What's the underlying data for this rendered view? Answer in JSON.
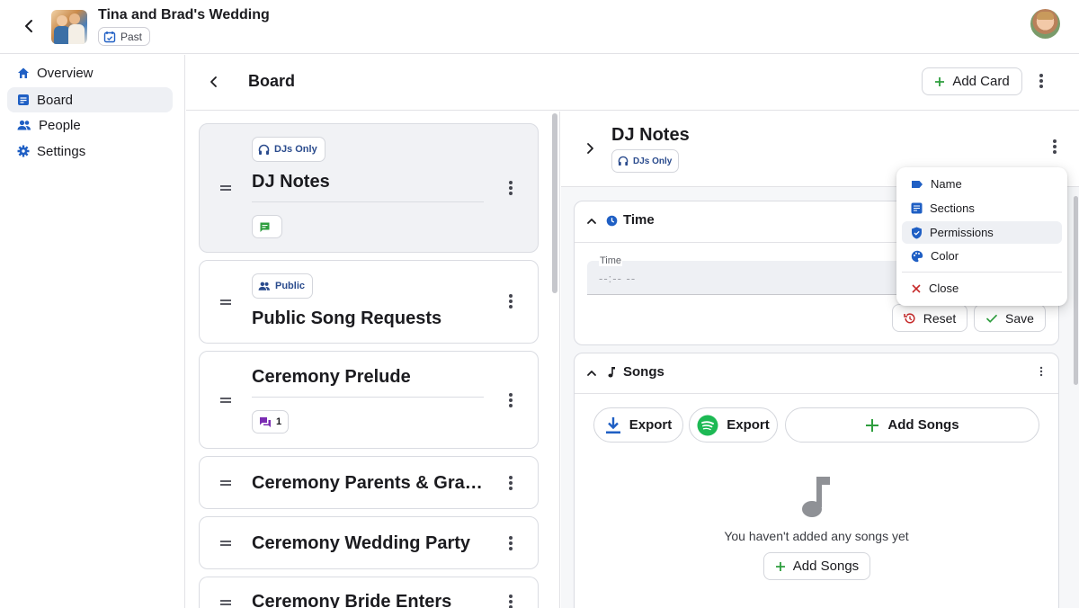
{
  "header": {
    "title": "Tina and Brad's Wedding",
    "status_chip": "Past"
  },
  "sidebar": {
    "items": [
      {
        "label": "Overview",
        "icon": "home-icon"
      },
      {
        "label": "Board",
        "icon": "board-icon",
        "active": true
      },
      {
        "label": "People",
        "icon": "people-icon"
      },
      {
        "label": "Settings",
        "icon": "gear-icon"
      }
    ]
  },
  "board": {
    "title": "Board",
    "add_card_label": "Add Card",
    "cards": [
      {
        "title": "DJ Notes",
        "chip": "DJs Only",
        "icon_chip": "",
        "selected": true
      },
      {
        "title": "Public Song Requests",
        "chip": "Public"
      },
      {
        "title": "Ceremony Prelude",
        "icon_chip": "1"
      },
      {
        "title": "Ceremony Parents & Gra…"
      },
      {
        "title": "Ceremony Wedding Party"
      },
      {
        "title": "Ceremony Bride Enters"
      }
    ]
  },
  "detail": {
    "title": "DJ Notes",
    "chip": "DJs Only",
    "time_section": {
      "title": "Time",
      "field_label": "Time",
      "field_value": "--:-- --",
      "reset_label": "Reset",
      "save_label": "Save"
    },
    "songs_section": {
      "title": "Songs",
      "export_file_label": "Export",
      "export_spotify_label": "Export",
      "add_songs_label": "Add Songs",
      "empty_text": "You haven't added any songs yet",
      "empty_add_label": "Add Songs"
    }
  },
  "menu": {
    "items": [
      "Name",
      "Sections",
      "Permissions",
      "Color"
    ],
    "close_label": "Close"
  },
  "colors": {
    "accent_blue": "#1f5fc4",
    "green": "#2e9e3e",
    "purple": "#7b2cb3",
    "red": "#c62828",
    "spotify": "#1db954"
  }
}
